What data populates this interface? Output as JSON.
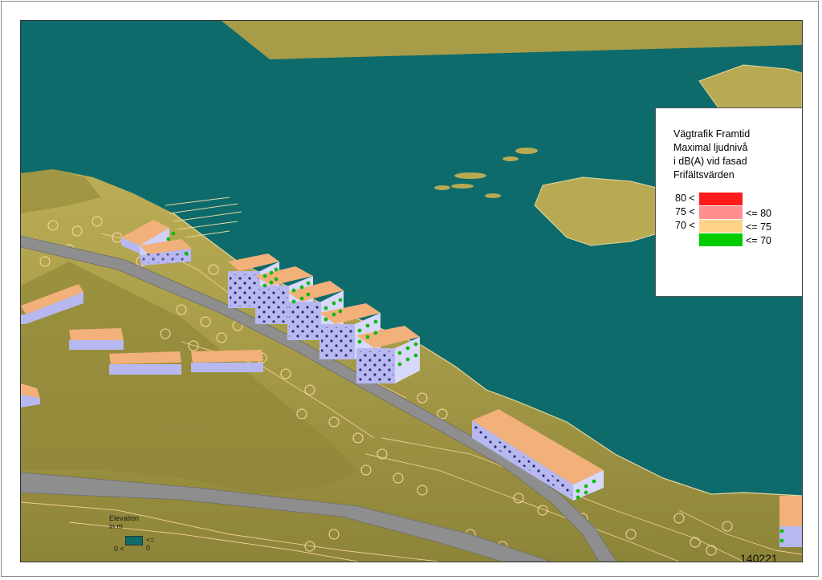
{
  "legend": {
    "title_lines": [
      "Vägtrafik Framtid",
      "Maximal ljudnivå",
      "i dB(A) vid fasad",
      "Frifältsvärden"
    ],
    "rows": [
      {
        "low": "80 <",
        "high": "",
        "color": "#ff1a1a"
      },
      {
        "low": "75 <",
        "high": "<= 80",
        "color": "#ff8f8f"
      },
      {
        "low": "70 <",
        "high": "<= 75",
        "color": "#ffd28a"
      },
      {
        "low": "",
        "high": "<= 70",
        "color": "#00cc00"
      }
    ]
  },
  "elevation_legend": {
    "title": "Elevation",
    "unit": "in m",
    "water_label": "<= 0",
    "land_label": "0 <"
  },
  "date_code": "140221",
  "colors": {
    "water": "#0d6b6b",
    "land": "#aea046",
    "road": "#8e8e8e",
    "roof": "#f2b07a",
    "facade": "#b8b8f0",
    "contour": "#ffd9a8"
  }
}
